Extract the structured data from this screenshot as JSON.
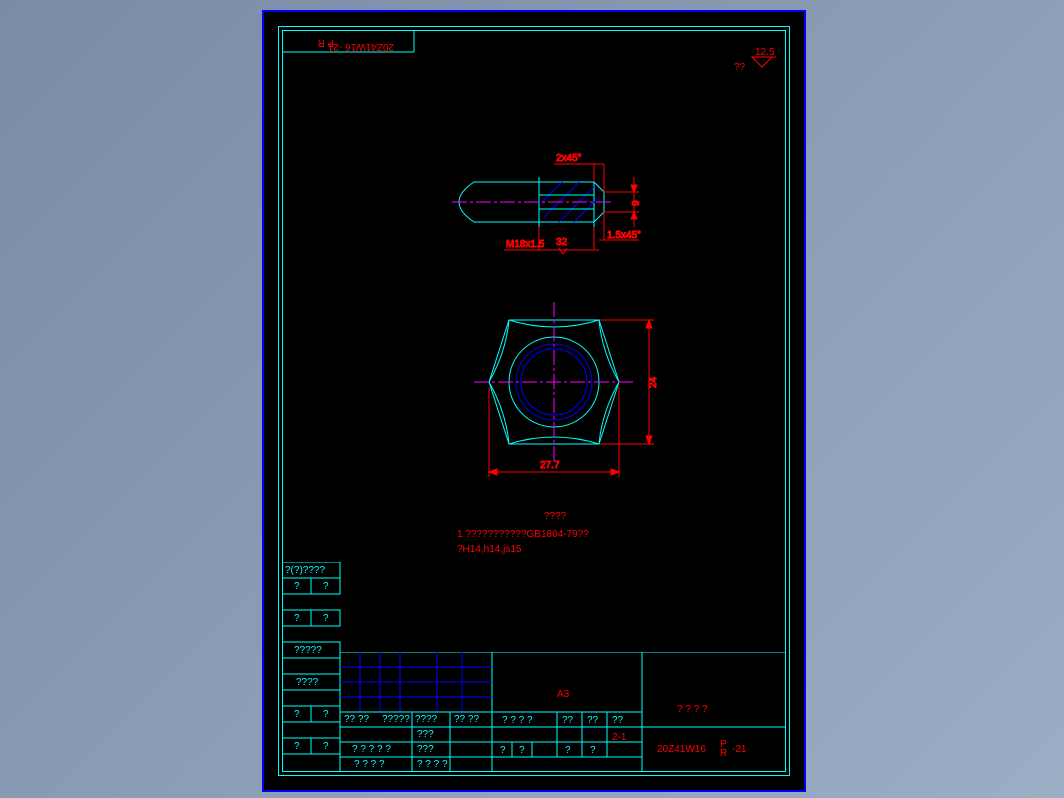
{
  "page": {
    "drawing_number_top": "20Z41W16  -21",
    "drawing_number_top_sub": "P R",
    "surface_finish": "12.5",
    "surface_mark": "??"
  },
  "side_view": {
    "chamfer1": "2x45°",
    "chamfer2": "1.5x45°",
    "thread": "M18x1.5",
    "thread_tol": "32",
    "dim_height": "9"
  },
  "front_view": {
    "width_dim": "27.7",
    "height_dim": "24"
  },
  "notes": {
    "title": "????",
    "line1": "1.???????????GB1804-79??",
    "line2": "?H14,h14,js15"
  },
  "leftblock": {
    "r1": "?(?)????",
    "r2a": "?",
    "r2b": "?",
    "r3a": "?",
    "r3b": "?",
    "r4": "?????",
    "r5": "????",
    "r6a": "?",
    "r6b": "?",
    "r7a": "?",
    "r7b": "?"
  },
  "titleblock": {
    "size": "A3",
    "title_main": "? ? ? ?",
    "drawing_no": "20Z41W16",
    "drawing_sub": "P R",
    "drawing_suffix": "-21",
    "scale": "2-1",
    "row_labels": {
      "a": "?? ??",
      "b": "?????",
      "c": "????",
      "d": "?? ??",
      "mid1": "???",
      "mid2": "???",
      "bot": "? ? ? ? ?",
      "bot2": "? ? ? ?",
      "s1": "? ? ? ?",
      "s2": "??",
      "s3": "??",
      "s4": "??",
      "b1": "?",
      "b2": "?",
      "b3": "?"
    }
  }
}
